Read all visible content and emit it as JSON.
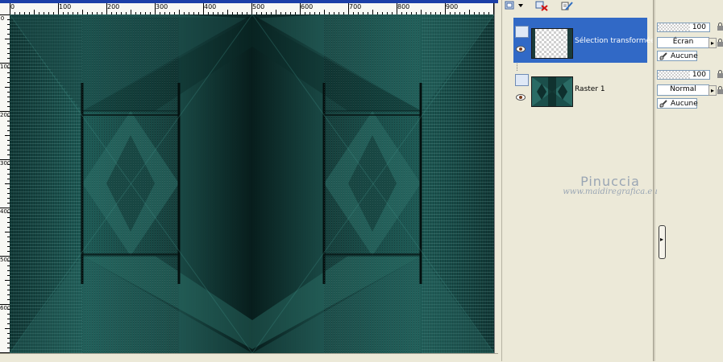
{
  "ruler": {
    "top_numbers": [
      "0",
      "100",
      "200",
      "300",
      "400",
      "500",
      "600",
      "700",
      "800",
      "900"
    ],
    "left_numbers": [
      "0",
      "100",
      "200",
      "300",
      "400",
      "500",
      "600"
    ]
  },
  "layers": [
    {
      "name": "Sélection transformée",
      "opacity": "100",
      "blend_mode": "Écran",
      "mask": "Aucune",
      "selected": true
    },
    {
      "name": "Raster 1",
      "opacity": "100",
      "blend_mode": "Normal",
      "mask": "Aucune",
      "selected": false
    }
  ],
  "watermark": {
    "title": "Pinuccia",
    "url": "www.maidiregrafica.eu"
  },
  "icons": {
    "new_layer": "new-layer-icon",
    "dropdown": "chevron-down-icon",
    "delete_layer": "delete-layer-icon",
    "edit_layer": "edit-layer-icon",
    "eye": "eye-icon",
    "lock": "lock-icon",
    "mask": "mask-link-icon"
  },
  "colors": {
    "title_bar": "#1c3fa8",
    "selection": "#3169c6",
    "canvas_teal": "#1d5450"
  }
}
